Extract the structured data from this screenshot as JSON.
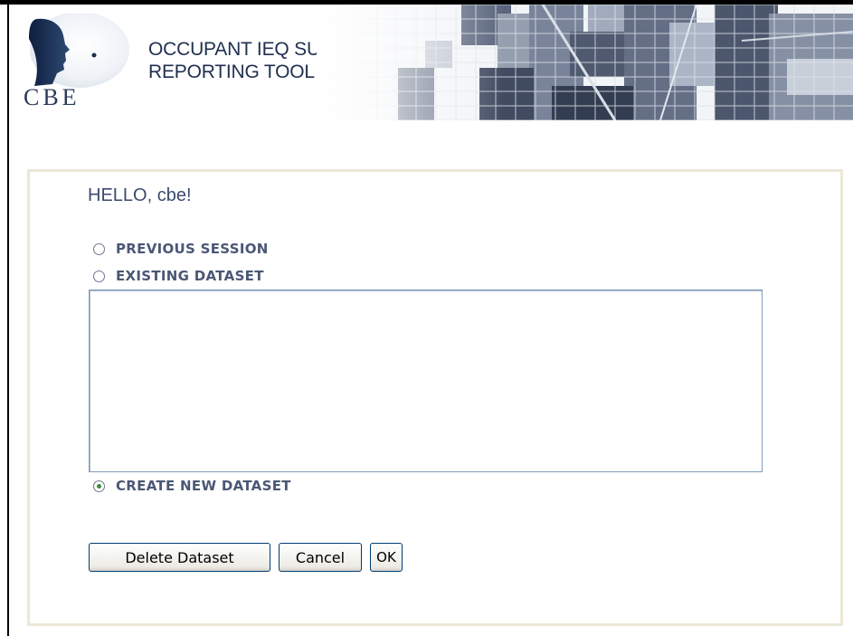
{
  "header": {
    "logo_text": "CBE",
    "title_line1": "OCCUPANT IEQ SURVEY",
    "title_line2": "REPORTING TOOL"
  },
  "panel": {
    "greeting": "HELLO, cbe!",
    "options": [
      {
        "label": "PREVIOUS SESSION",
        "selected": false
      },
      {
        "label": "EXISTING DATASET",
        "selected": false
      },
      {
        "label": "CREATE NEW DATASET",
        "selected": true
      }
    ],
    "dataset_list": []
  },
  "buttons": {
    "delete_label": "Delete Dataset",
    "cancel_label": "Cancel",
    "ok_label": "OK"
  },
  "colors": {
    "title": "#1f2f4f",
    "greeting": "#3c4a6e",
    "option_text": "#4b5775",
    "panel_border": "#ece8d8",
    "radio_checked": "#3a8a3a"
  }
}
